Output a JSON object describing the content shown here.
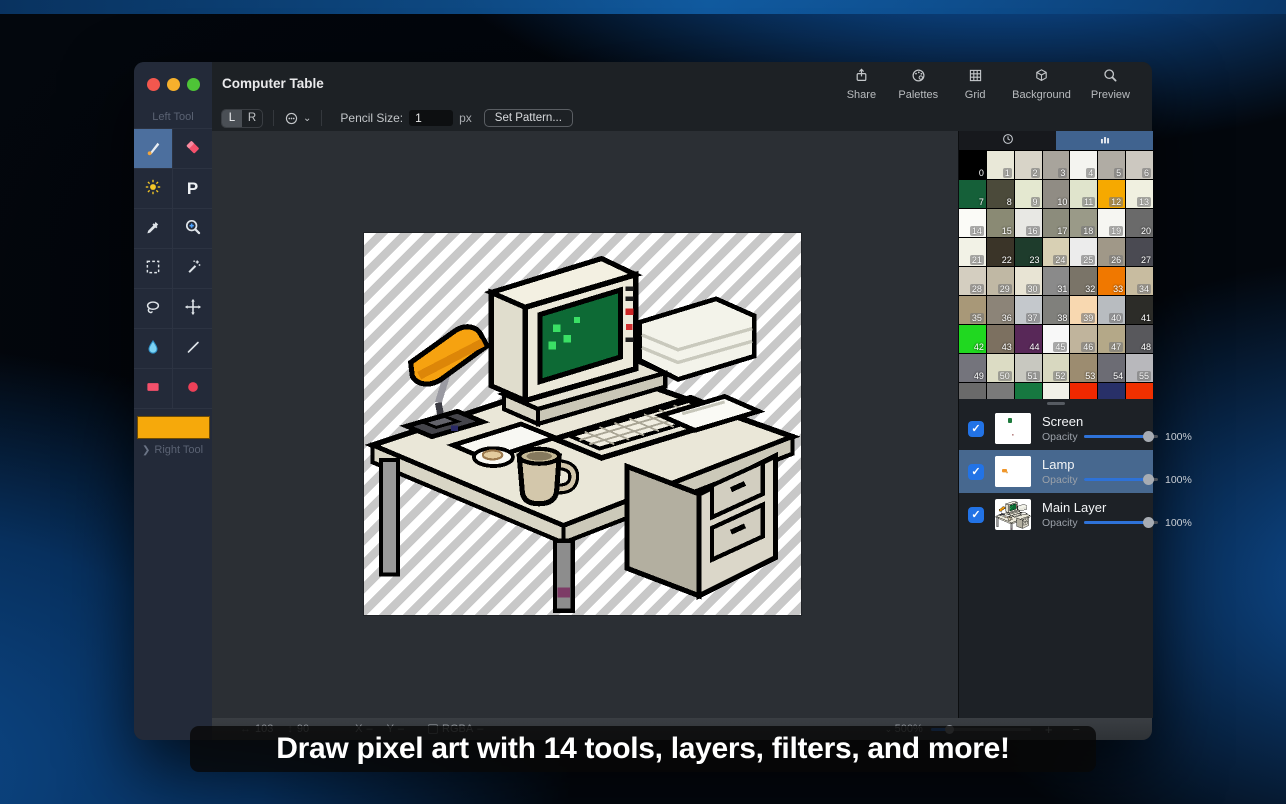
{
  "window": {
    "title": "Computer Table",
    "traffic_lights": {
      "red": "#f3574e",
      "yellow": "#f6b02c",
      "green": "#4ec437"
    }
  },
  "titlebar": {
    "actions": [
      {
        "label": "Share",
        "icon": "share"
      },
      {
        "label": "Palettes",
        "icon": "palettes"
      },
      {
        "label": "Grid",
        "icon": "grid"
      },
      {
        "label": "Background",
        "icon": "background"
      },
      {
        "label": "Preview",
        "icon": "preview"
      }
    ]
  },
  "options_bar": {
    "segments": [
      "L",
      "R"
    ],
    "selected_segment": "L",
    "pencil_size_label": "Pencil Size:",
    "pencil_size_value": "1",
    "pencil_unit": "px",
    "set_pattern_label": "Set Pattern..."
  },
  "sidebar": {
    "left_tool_label": "Left Tool",
    "right_tool_label": "Right Tool",
    "current_color": "#f6a90b",
    "tools": [
      {
        "name": "brush",
        "selected": true
      },
      {
        "name": "eraser",
        "selected": false
      },
      {
        "name": "lighten",
        "selected": false
      },
      {
        "name": "letter-p",
        "selected": false
      },
      {
        "name": "eyedropper",
        "selected": false
      },
      {
        "name": "zoom",
        "selected": false
      },
      {
        "name": "marquee",
        "selected": false
      },
      {
        "name": "magic-wand",
        "selected": false
      },
      {
        "name": "lasso",
        "selected": false
      },
      {
        "name": "move",
        "selected": false
      },
      {
        "name": "droplet",
        "selected": false
      },
      {
        "name": "line",
        "selected": false
      },
      {
        "name": "filled-rect",
        "selected": false
      },
      {
        "name": "filled-ellipse",
        "selected": false
      }
    ]
  },
  "palette": {
    "tabs": [
      {
        "icon": "clock",
        "selected": false
      },
      {
        "icon": "bars",
        "selected": true
      }
    ],
    "swatches": [
      "#000000",
      "#e9e8d8",
      "#d8d4c8",
      "#a8a49c",
      "#f4f4f0",
      "#b0aca4",
      "#ccc8c0",
      "#156039",
      "#4b4a3a",
      "#e4e8d0",
      "#908c84",
      "#e0e4cc",
      "#f6a900",
      "#f0f0e0",
      "#fbfbf7",
      "#8a8a74",
      "#e8e8e4",
      "#8c8c7c",
      "#9a9a88",
      "#f6f6f2",
      "#6a6a6a",
      "#f2f2e6",
      "#3a3428",
      "#1e3c2c",
      "#d8d0b4",
      "#ececec",
      "#a09888",
      "#4a4a52",
      "#d4cec0",
      "#c0b8a4",
      "#e8e4d4",
      "#8a8a8a",
      "#7a7468",
      "#f07800",
      "#c8bca0",
      "#a89878",
      "#8c8478",
      "#c4c8cc",
      "#80807c",
      "#f8d8b0",
      "#b8bcc0",
      "#2c2c28",
      "#20d820",
      "#7c7060",
      "#582858",
      "#f8f8f8",
      "#c0b49c",
      "#b4a888",
      "#58585c",
      "#74747c",
      "#dcdcc4",
      "#c8c8c0",
      "#d8d8c0",
      "#9c8c70",
      "#6c6c74",
      "#b8b8bc",
      "#6a6a6a",
      "#7a7a7a",
      "#167840",
      "#f0f0e8",
      "#f02800",
      "#283068",
      "#f03000"
    ]
  },
  "layers": [
    {
      "name": "Screen",
      "opacity_label": "Opacity",
      "opacity_value": "100%",
      "checked": true,
      "selected": false,
      "thumb": "screen"
    },
    {
      "name": "Lamp",
      "opacity_label": "Opacity",
      "opacity_value": "100%",
      "checked": true,
      "selected": true,
      "thumb": "lamp"
    },
    {
      "name": "Main Layer",
      "opacity_label": "Opacity",
      "opacity_value": "100%",
      "checked": true,
      "selected": false,
      "thumb": "main"
    }
  ],
  "statusbar": {
    "canvas_width": "103",
    "canvas_height": "90",
    "x_label": "X",
    "x_value": "–",
    "y_label": "Y",
    "y_value": "–",
    "rgba_label": "RGBA",
    "rgba_value": "–",
    "zoom_value": "500%",
    "zoom_in": "+",
    "zoom_out": "−"
  },
  "caption": {
    "text": "Draw pixel art with 14 tools, layers, filters, and more!"
  }
}
